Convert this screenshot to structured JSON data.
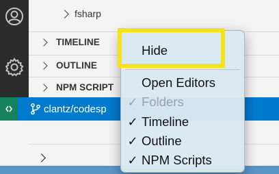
{
  "explorer": {
    "child_item": "fsharp",
    "sections": {
      "timeline": "TIMELINE",
      "outline": "OUTLINE",
      "npm_scripts": "NPM SCRIPT"
    }
  },
  "statusbar": {
    "branch": "clantz/codesp"
  },
  "context_menu": {
    "hide": "Hide",
    "open_editors": "Open Editors",
    "folders": "Folders",
    "timeline": "Timeline",
    "outline": "Outline",
    "npm_scripts": "NPM Scripts",
    "checkmark": "✓",
    "checked": {
      "open_editors": false,
      "folders": true,
      "timeline": true,
      "outline": true,
      "npm_scripts": true
    },
    "disabled": {
      "folders": true
    }
  },
  "colors": {
    "statusbar_bg": "#007acc",
    "remote_bg": "#16825d",
    "highlight": "#f6e21a",
    "activity_bar": "#2c2c2c"
  },
  "icons": {
    "account": "account-icon",
    "settings": "gear-icon",
    "remote": "remote-icon",
    "branch": "git-branch-icon"
  }
}
